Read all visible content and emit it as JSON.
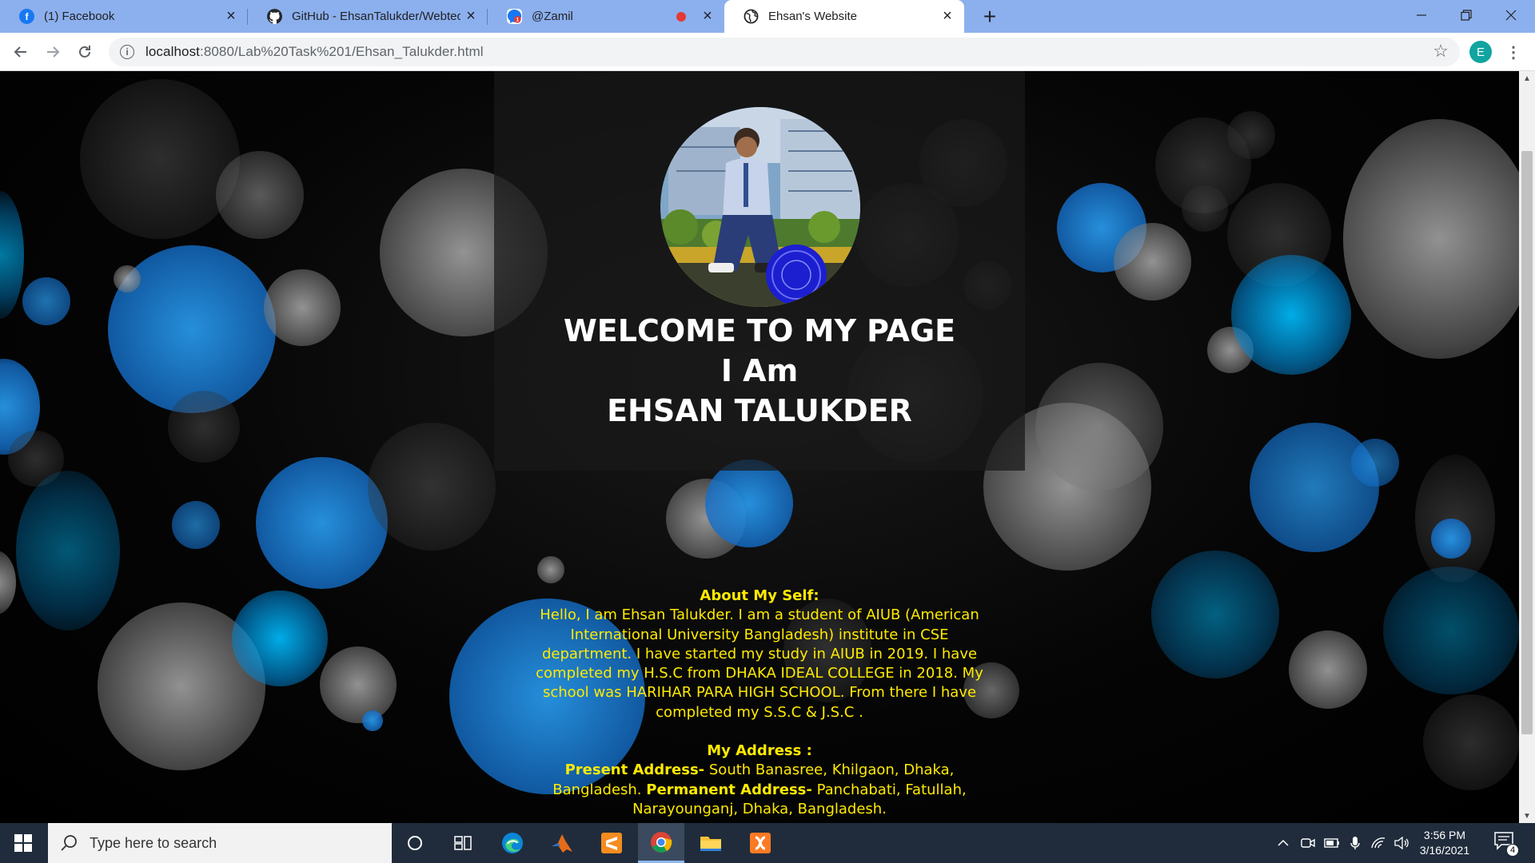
{
  "browser": {
    "tabs": [
      {
        "label": "(1) Facebook",
        "favicon": "facebook-icon",
        "color": "#1877f2"
      },
      {
        "label": "GitHub - EhsanTalukder/Webtech",
        "favicon": "github-icon",
        "color": "#24292e"
      },
      {
        "label": "@Zamil",
        "favicon": "messenger-icon",
        "color": "#e53935",
        "recording": true
      },
      {
        "label": "Ehsan's Website",
        "favicon": "globe-icon",
        "color": "#202124",
        "active": true
      }
    ],
    "url_host": "localhost",
    "url_rest": ":8080/Lab%20Task%201/Ehsan_Talukder.html",
    "profile_initial": "E"
  },
  "page": {
    "hero": {
      "line1": "WELCOME TO MY PAGE",
      "line2": "I Am",
      "line3": "EHSAN TALUKDER"
    },
    "about": {
      "heading": "About My Self:",
      "text": "Hello, I am Ehsan Talukder. I am a student of AIUB (American International University Bangladesh) institute in CSE department. I have started my study in AIUB in 2019. I have completed my H.S.C from DHAKA IDEAL COLLEGE in 2018. My school was HARIHAR PARA HIGH SCHOOL. From there I have completed my S.S.C & J.S.C ."
    },
    "address": {
      "heading": "My Address :",
      "present_label": "Present Address-",
      "present_value": " South Banasree, Khilgaon, Dhaka, Bangladesh. ",
      "permanent_label": "Permanent Address-",
      "permanent_value": " Panchabati, Fatullah, Narayounganj, Dhaka, Bangladesh."
    },
    "text_color": "#ffea00"
  },
  "taskbar": {
    "search_placeholder": "Type here to search",
    "time": "3:56 PM",
    "date": "3/16/2021",
    "notification_count": "4"
  }
}
